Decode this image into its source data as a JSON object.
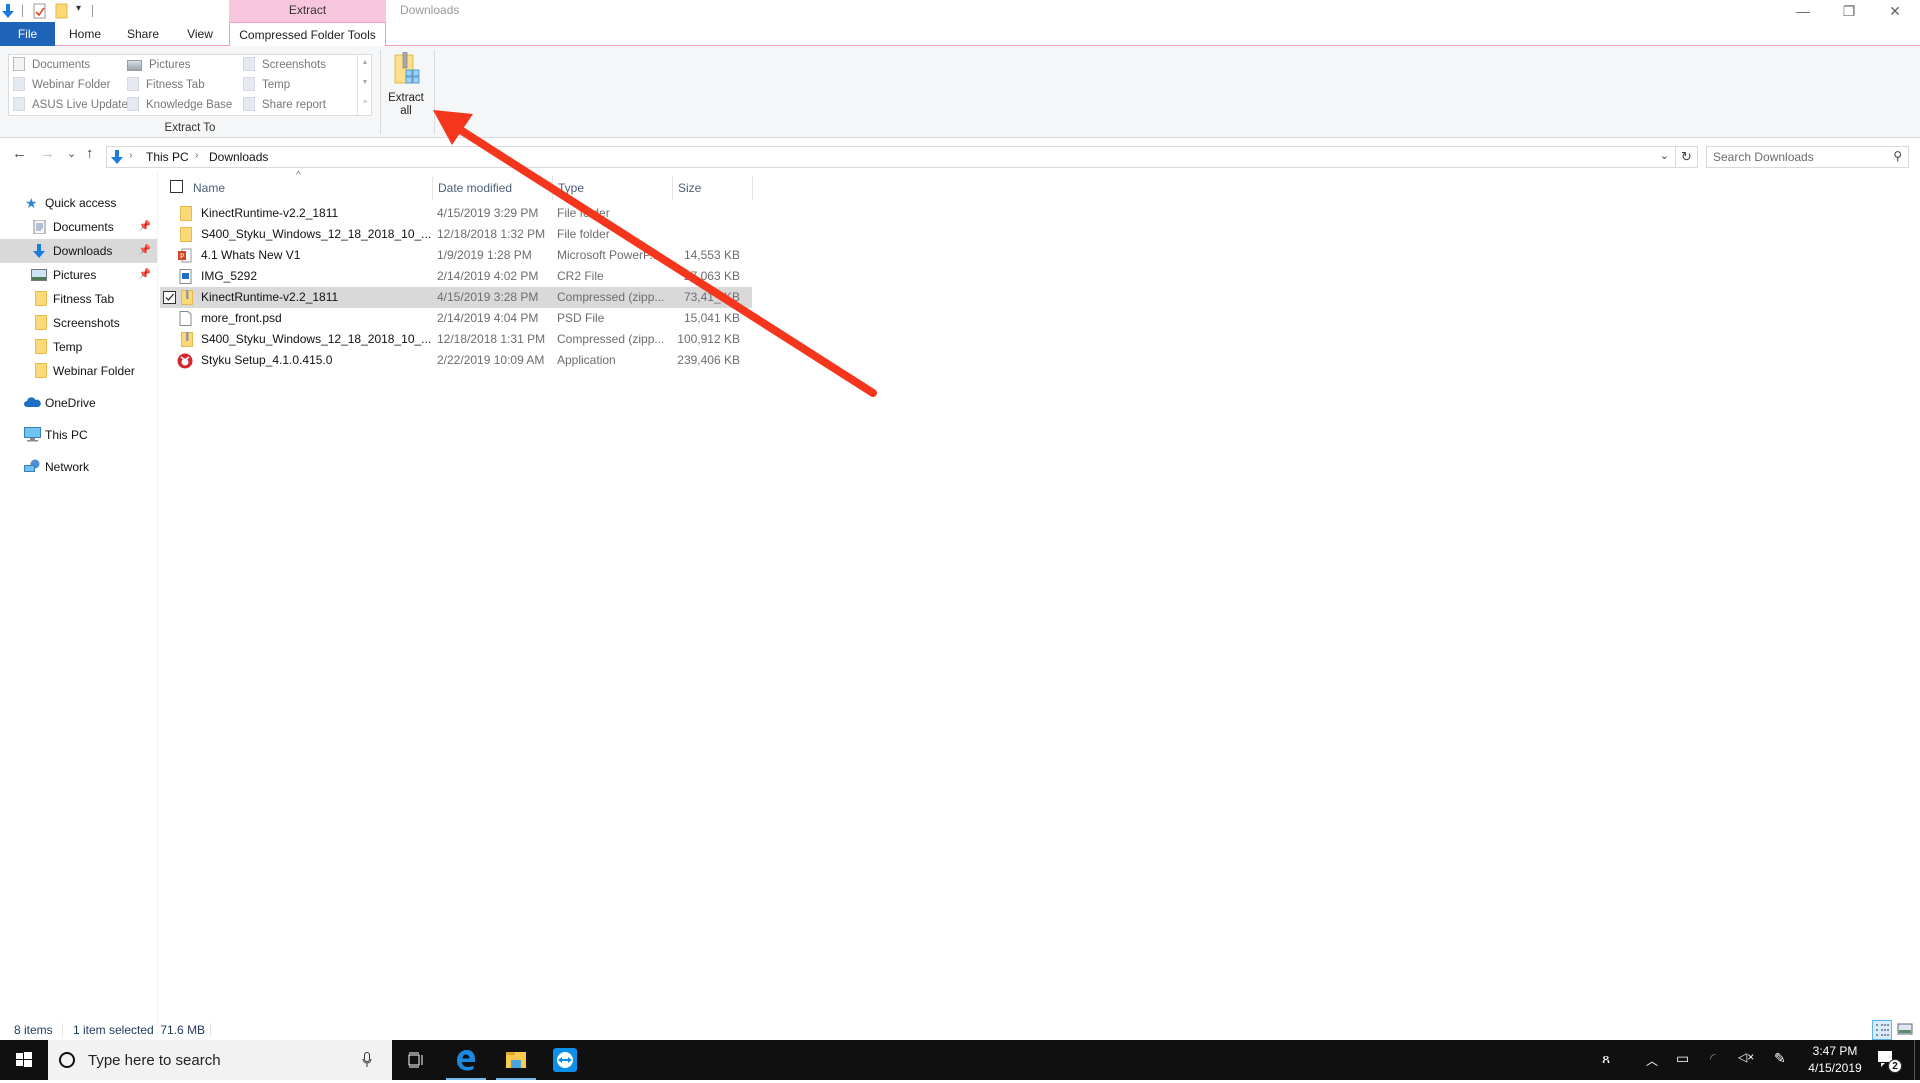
{
  "window": {
    "title": "Downloads",
    "context_tab_header": "Extract",
    "controls": {
      "minimize": "—",
      "restore": "❐",
      "close": "✕"
    }
  },
  "quick_access_toolbar": {
    "icons": [
      "downloads-icon",
      "properties-icon",
      "new-folder-icon",
      "customize-dropdown-icon"
    ]
  },
  "ribbon": {
    "tabs": [
      {
        "label": "File"
      },
      {
        "label": "Home"
      },
      {
        "label": "Share"
      },
      {
        "label": "View"
      },
      {
        "label": "Compressed Folder Tools",
        "active": true
      }
    ],
    "extract_to": {
      "group_label": "Extract To",
      "items": [
        {
          "label": "Documents",
          "icon": "documents-icon"
        },
        {
          "label": "Pictures",
          "icon": "pictures-icon"
        },
        {
          "label": "Screenshots",
          "icon": "folder-icon"
        },
        {
          "label": "Webinar Folder",
          "icon": "folder-icon"
        },
        {
          "label": "Fitness Tab",
          "icon": "folder-icon"
        },
        {
          "label": "Temp",
          "icon": "folder-icon"
        },
        {
          "label": "ASUS Live Update",
          "icon": "folder-icon"
        },
        {
          "label": "Knowledge Base",
          "icon": "folder-icon"
        },
        {
          "label": "Share report",
          "icon": "folder-icon"
        }
      ]
    },
    "extract_all": {
      "line1": "Extract",
      "line2": "all"
    },
    "help": "?"
  },
  "navigation": {
    "back": "←",
    "forward": "→",
    "recent": "⌄",
    "up": "↑",
    "breadcrumb": [
      "This PC",
      "Downloads"
    ],
    "refresh": "↻",
    "search_placeholder": "Search Downloads"
  },
  "nav_pane": {
    "quick_access": {
      "label": "Quick access"
    },
    "quick_items": [
      {
        "label": "Documents",
        "pinned": true
      },
      {
        "label": "Downloads",
        "pinned": true,
        "selected": true
      },
      {
        "label": "Pictures",
        "pinned": true
      },
      {
        "label": "Fitness Tab",
        "pinned": false
      },
      {
        "label": "Screenshots",
        "pinned": false
      },
      {
        "label": "Temp",
        "pinned": false
      },
      {
        "label": "Webinar Folder",
        "pinned": false
      }
    ],
    "locations": [
      {
        "label": "OneDrive"
      },
      {
        "label": "This PC"
      },
      {
        "label": "Network"
      }
    ]
  },
  "file_list": {
    "columns": [
      "Name",
      "Date modified",
      "Type",
      "Size"
    ],
    "rows": [
      {
        "name": "KinectRuntime-v2.2_1811",
        "date": "4/15/2019 3:29 PM",
        "type": "File folder",
        "size": "",
        "icon": "folder-icon"
      },
      {
        "name": "S400_Styku_Windows_12_18_2018_10_...",
        "date": "12/18/2018 1:32 PM",
        "type": "File folder",
        "size": "",
        "icon": "folder-icon"
      },
      {
        "name": "4.1 Whats New V1",
        "date": "1/9/2019 1:28 PM",
        "type": "Microsoft PowerP...",
        "size": "14,553 KB",
        "icon": "powerpoint-icon"
      },
      {
        "name": "IMG_5292",
        "date": "2/14/2019 4:02 PM",
        "type": "CR2 File",
        "size": "27,063 KB",
        "icon": "image-file-icon"
      },
      {
        "name": "KinectRuntime-v2.2_1811",
        "date": "4/15/2019 3:28 PM",
        "type": "Compressed (zipp...",
        "size": "73,41_ KB",
        "icon": "zip-folder-icon",
        "selected": true
      },
      {
        "name": "more_front.psd",
        "date": "2/14/2019 4:04 PM",
        "type": "PSD File",
        "size": "15,041 KB",
        "icon": "blank-file-icon"
      },
      {
        "name": "S400_Styku_Windows_12_18_2018_10_...",
        "date": "12/18/2018 1:31 PM",
        "type": "Compressed (zipp...",
        "size": "100,912 KB",
        "icon": "zip-folder-icon"
      },
      {
        "name": "Styku Setup_4.1.0.415.0",
        "date": "2/22/2019 10:09 AM",
        "type": "Application",
        "size": "239,406 KB",
        "icon": "styku-app-icon"
      }
    ]
  },
  "status_bar": {
    "item_count": "8 items",
    "selection": "1 item selected  71.6 MB"
  },
  "taskbar": {
    "search_placeholder": "Type here to search",
    "apps": [
      "task-view-icon",
      "edge-icon",
      "file-explorer-icon",
      "teamviewer-icon"
    ],
    "clock_time": "3:47 PM",
    "clock_date": "4/15/2019",
    "notification_count": "2"
  },
  "annotation": {
    "color": "#f4361d",
    "description": "red arrow pointing to Extract all button"
  }
}
